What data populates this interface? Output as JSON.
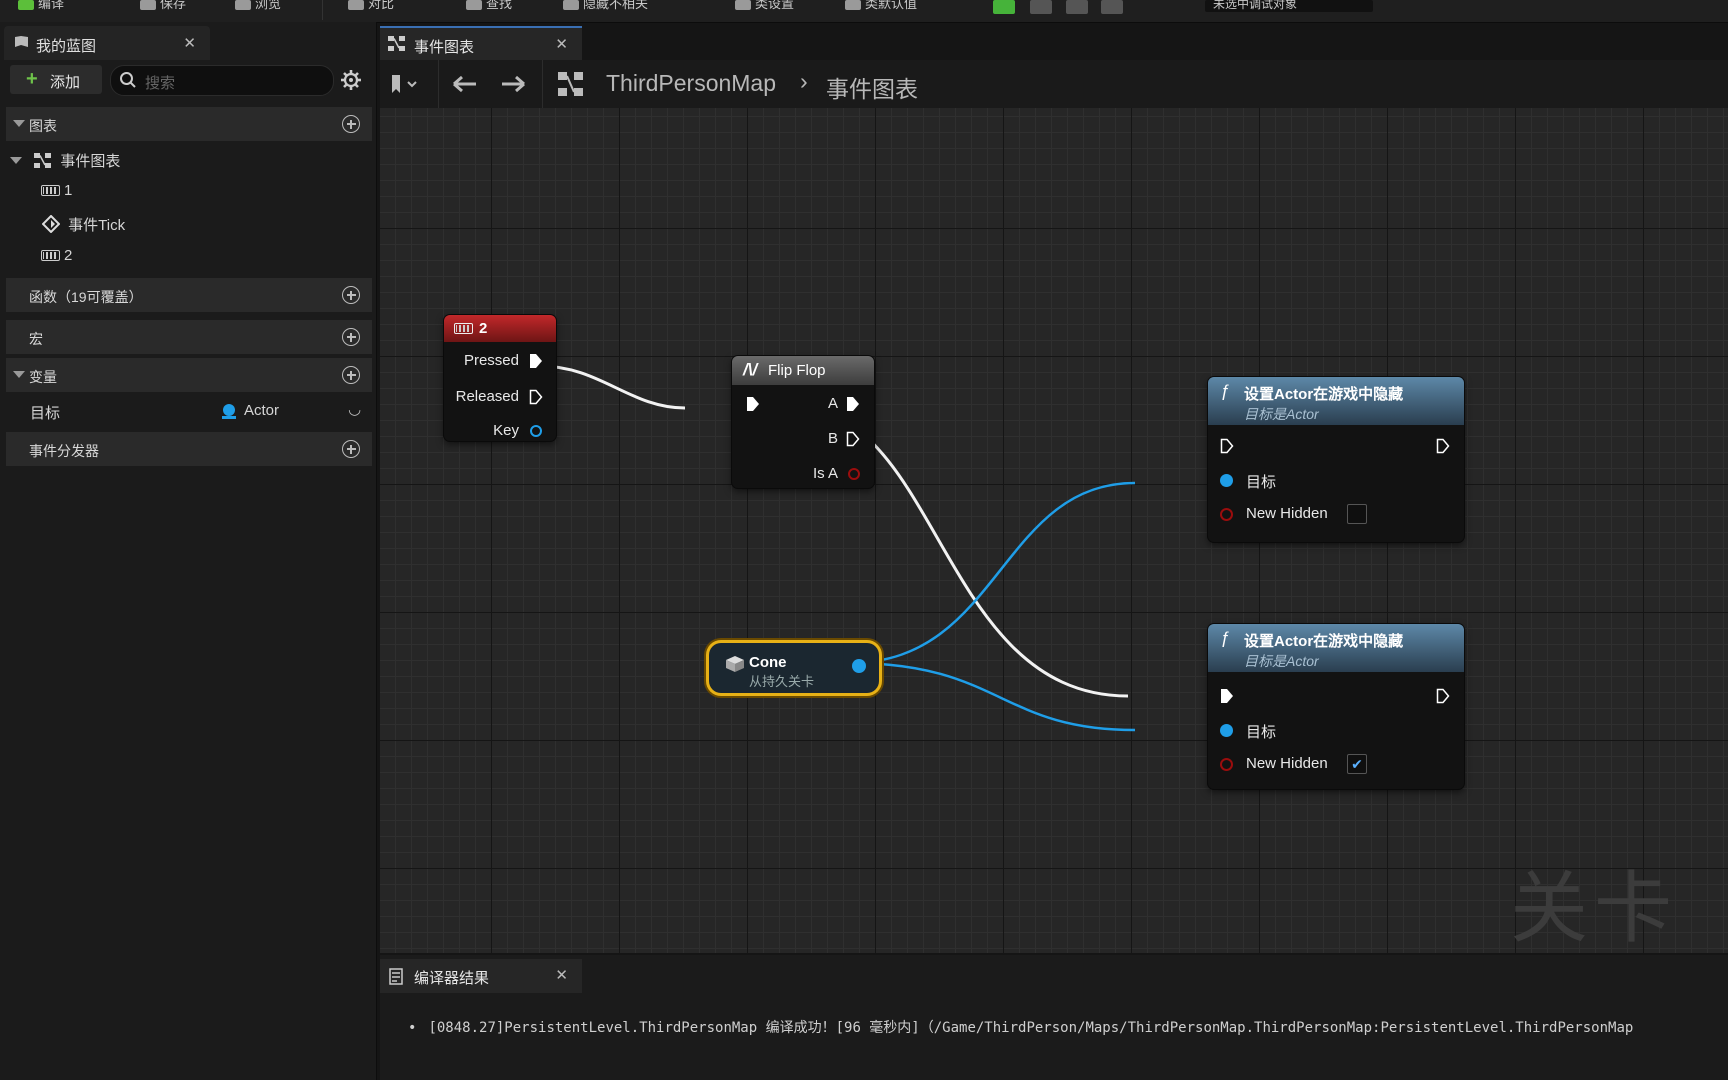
{
  "toolbar": {
    "items": [
      {
        "label": "编译",
        "icon": "compile-icon"
      },
      {
        "label": "保存",
        "icon": "save-icon"
      },
      {
        "label": "浏览",
        "icon": "browse-icon"
      },
      {
        "label": "对比",
        "icon": "diff-icon"
      },
      {
        "label": "查找",
        "icon": "find-icon"
      },
      {
        "label": "隐藏不相关",
        "icon": "hide-unrelated-icon"
      },
      {
        "label": "类设置",
        "icon": "class-settings-icon"
      },
      {
        "label": "类默认值",
        "icon": "class-defaults-icon"
      }
    ],
    "debug_select": "未选中调试对象"
  },
  "left_panel": {
    "tab_title": "我的蓝图",
    "add_label": "添加",
    "search_placeholder": "搜索",
    "sections": {
      "graphs": "图表",
      "functions": "函数（19可覆盖）",
      "macros": "宏",
      "variables": "变量",
      "dispatchers": "事件分发器"
    },
    "tree": {
      "event_graph": "事件图表",
      "items": [
        "1",
        "事件Tick",
        "2"
      ]
    },
    "variable": {
      "name": "目标",
      "type": "Actor"
    }
  },
  "graph": {
    "tab_title": "事件图表",
    "breadcrumb": {
      "root": "ThirdPersonMap",
      "current": "事件图表"
    },
    "watermark": "关卡蓝",
    "nodes": {
      "key2": {
        "title": "2",
        "pins": [
          "Pressed",
          "Released",
          "Key"
        ]
      },
      "flipflop": {
        "title": "Flip Flop",
        "pins": [
          "A",
          "B",
          "Is A"
        ]
      },
      "cone": {
        "title": "Cone",
        "subtitle": "从持久关卡"
      },
      "set_hidden_1": {
        "title": "设置Actor在游戏中隐藏",
        "subtitle": "目标是Actor",
        "pin_target": "目标",
        "pin_hidden": "New Hidden",
        "checked": false
      },
      "set_hidden_2": {
        "title": "设置Actor在游戏中隐藏",
        "subtitle": "目标是Actor",
        "pin_target": "目标",
        "pin_hidden": "New Hidden",
        "checked": true
      }
    }
  },
  "compiler": {
    "tab_title": "编译器结果",
    "message": "[0848.27]PersistentLevel.ThirdPersonMap 编译成功！[96 毫秒内]（/Game/ThirdPerson/Maps/ThirdPersonMap.ThirdPersonMap:PersistentLevel.ThirdPersonMap"
  },
  "colors": {
    "accent": "#3a6fb3",
    "exec": "#ffffff",
    "object_pin": "#1f9ee8",
    "bool_pin": "#9b0d0d",
    "key_header": "#8c1c1c",
    "func_header": "#3f5e78"
  }
}
